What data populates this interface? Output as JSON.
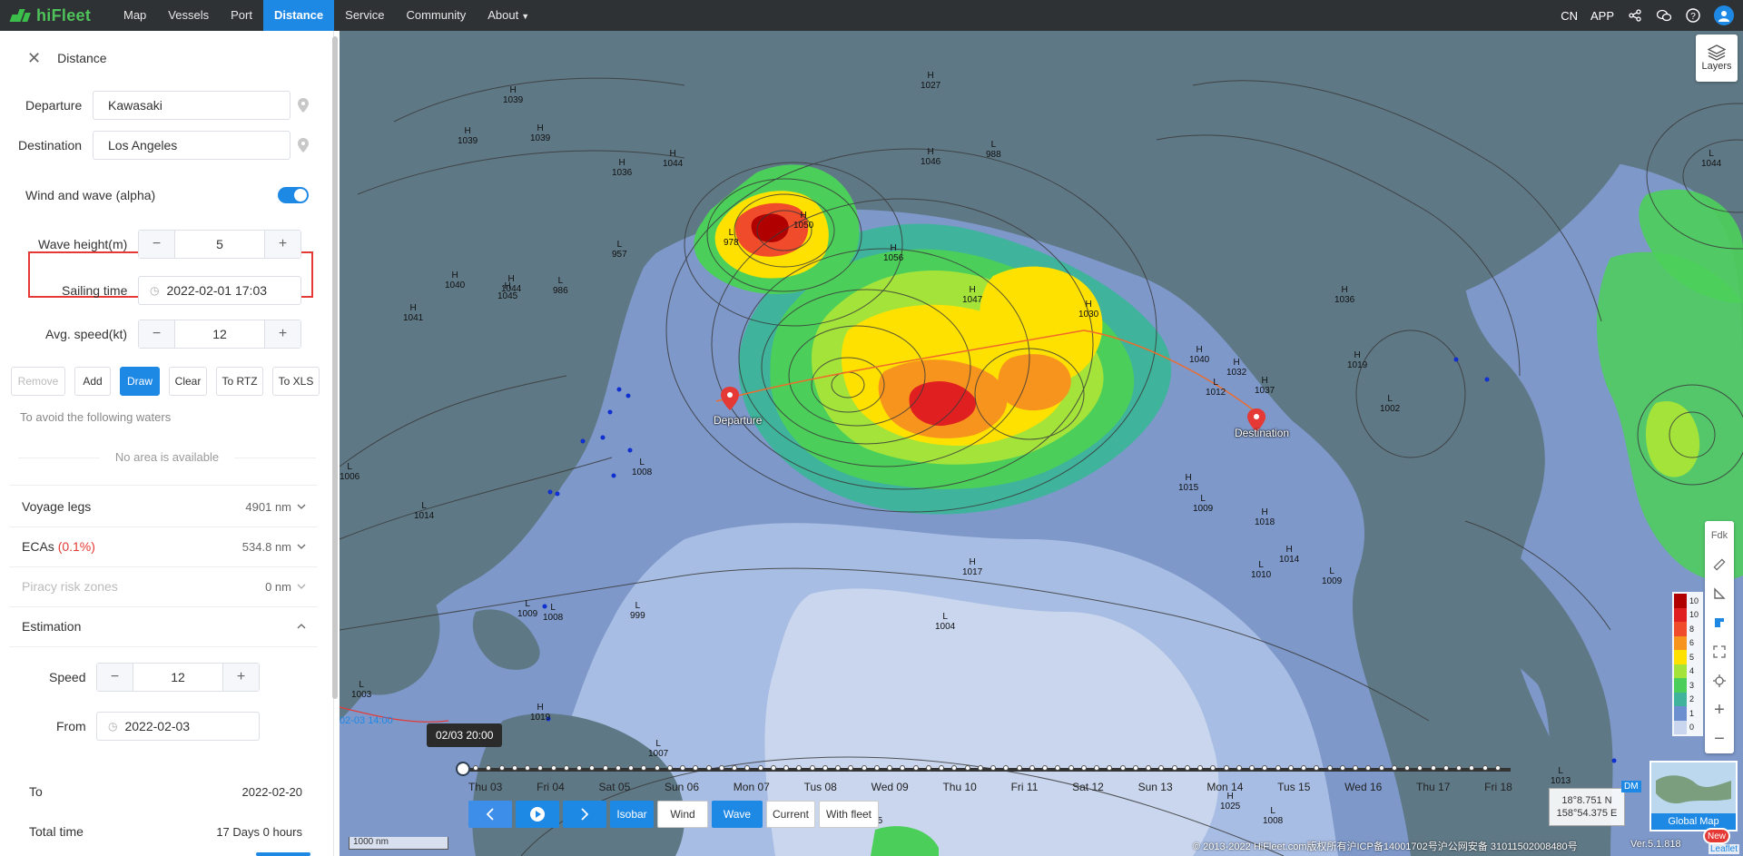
{
  "app": {
    "brand": "hiFleet"
  },
  "nav": {
    "items": [
      "Map",
      "Vessels",
      "Port",
      "Distance",
      "Service",
      "Community",
      "About"
    ],
    "active": "Distance"
  },
  "topright": {
    "lang": "CN",
    "app": "APP"
  },
  "panel": {
    "title": "Distance",
    "departure_label": "Departure",
    "departure_value": "Kawasaki",
    "destination_label": "Destination",
    "destination_value": "Los Angeles",
    "windwave_label": "Wind and wave (alpha)",
    "windwave_on": true,
    "wave_height_label": "Wave height(m)",
    "wave_height_value": "5",
    "sailing_time_label": "Sailing time",
    "sailing_time_value": "2022-02-01 17:03",
    "avg_speed_label": "Avg. speed(kt)",
    "avg_speed_value": "12",
    "buttons": {
      "remove": "Remove",
      "add": "Add",
      "draw": "Draw",
      "clear": "Clear",
      "to_rtz": "To RTZ",
      "to_xls": "To XLS"
    },
    "avoid_text": "To avoid the following waters",
    "no_area_text": "No area is available",
    "voyage_legs_label": "Voyage legs",
    "voyage_legs_value": "4901 nm",
    "ecas_label": "ECAs",
    "ecas_pct": "(0.1%)",
    "ecas_value": "534.8 nm",
    "piracy_label": "Piracy risk zones",
    "piracy_value": "0 nm",
    "estimation_label": "Estimation",
    "speed_label": "Speed",
    "speed_value": "12",
    "from_label": "From",
    "from_value": "2022-02-03",
    "to_label": "To",
    "to_value": "2022-02-20",
    "total_time_label": "Total time",
    "total_time_value": "17 Days 0 hours"
  },
  "map": {
    "layers_label": "Layers",
    "departure_marker": "Departure",
    "destination_marker": "Destination",
    "time_left_label": "02-03 14:00",
    "tooltip_time": "02/03 20:00",
    "days": [
      "Thu 03",
      "Fri 04",
      "Sat 05",
      "Sun 06",
      "Mon 07",
      "Tus 08",
      "Wed 09",
      "Thu 10",
      "Fri 11",
      "Sat 12",
      "Sun 13",
      "Mon 14",
      "Tus 15",
      "Wed 16",
      "Thu 17",
      "Fri 18"
    ],
    "controls": {
      "isobar": "Isobar",
      "wind": "Wind",
      "wave": "Wave",
      "current": "Current",
      "with_fleet": "With fleet"
    },
    "scale": "1000 nm",
    "coords_lat": "18°8.751 N",
    "coords_lon": "158°54.375 E",
    "dm": "DM",
    "global_map": "Global Map",
    "new_badge": "New",
    "fdk": "Fdk",
    "footer": "© 2013-2022 HiFleet.com版权所有沪ICP备14001702号沪公网安备 31011502008480号",
    "version": "Ver.5.1.818",
    "leaflet": "Leaflet",
    "legend": [
      {
        "label": "10",
        "color": "#b00000"
      },
      {
        "label": "10",
        "color": "#e02020"
      },
      {
        "label": "8",
        "color": "#f04b2a"
      },
      {
        "label": "6",
        "color": "#f7941d"
      },
      {
        "label": "5",
        "color": "#ffe100"
      },
      {
        "label": "4",
        "color": "#a3e33a"
      },
      {
        "label": "3",
        "color": "#4ccf5a"
      },
      {
        "label": "2",
        "color": "#3fb39b"
      },
      {
        "label": "1",
        "color": "#6b8fcf"
      },
      {
        "label": "0",
        "color": "#c9d6ee"
      }
    ],
    "isobar_labels": [
      {
        "t": "H",
        "v": "1039"
      },
      {
        "t": "H",
        "v": "1039"
      },
      {
        "t": "H",
        "v": "1039"
      },
      {
        "t": "H",
        "v": "1027"
      },
      {
        "t": "H",
        "v": "1036"
      },
      {
        "t": "H",
        "v": "1044"
      },
      {
        "t": "H",
        "v": "1046"
      },
      {
        "t": "L",
        "v": "988"
      },
      {
        "t": "L",
        "v": "1044"
      },
      {
        "t": "L",
        "v": "957"
      },
      {
        "t": "L",
        "v": "978"
      },
      {
        "t": "H",
        "v": "1056"
      },
      {
        "t": "H",
        "v": "1050"
      },
      {
        "t": "H",
        "v": "1045"
      },
      {
        "t": "H",
        "v": "1044"
      },
      {
        "t": "H",
        "v": "1040"
      },
      {
        "t": "L",
        "v": "986"
      },
      {
        "t": "H",
        "v": "1041"
      },
      {
        "t": "H",
        "v": "1047"
      },
      {
        "t": "H",
        "v": "1030"
      },
      {
        "t": "H",
        "v": "1036"
      },
      {
        "t": "H",
        "v": "1040"
      },
      {
        "t": "H",
        "v": "1032"
      },
      {
        "t": "H",
        "v": "1037"
      },
      {
        "t": "L",
        "v": "1012"
      },
      {
        "t": "H",
        "v": "1019"
      },
      {
        "t": "L",
        "v": "1002"
      },
      {
        "t": "L",
        "v": "1008"
      },
      {
        "t": "L",
        "v": "1006"
      },
      {
        "t": "L",
        "v": "1014"
      },
      {
        "t": "H",
        "v": "1015"
      },
      {
        "t": "L",
        "v": "1009"
      },
      {
        "t": "H",
        "v": "1018"
      },
      {
        "t": "H",
        "v": "1017"
      },
      {
        "t": "H",
        "v": "1014"
      },
      {
        "t": "L",
        "v": "1010"
      },
      {
        "t": "L",
        "v": "1009"
      },
      {
        "t": "L",
        "v": "1009"
      },
      {
        "t": "L",
        "v": "1008"
      },
      {
        "t": "L",
        "v": "999"
      },
      {
        "t": "L",
        "v": "1004"
      },
      {
        "t": "L",
        "v": "1003"
      },
      {
        "t": "H",
        "v": "1019"
      },
      {
        "t": "L",
        "v": "1007"
      },
      {
        "t": "L",
        "v": "1013"
      },
      {
        "t": "H",
        "v": "1025"
      },
      {
        "t": "H",
        "v": "1025"
      },
      {
        "t": "L",
        "v": "1008"
      }
    ]
  }
}
